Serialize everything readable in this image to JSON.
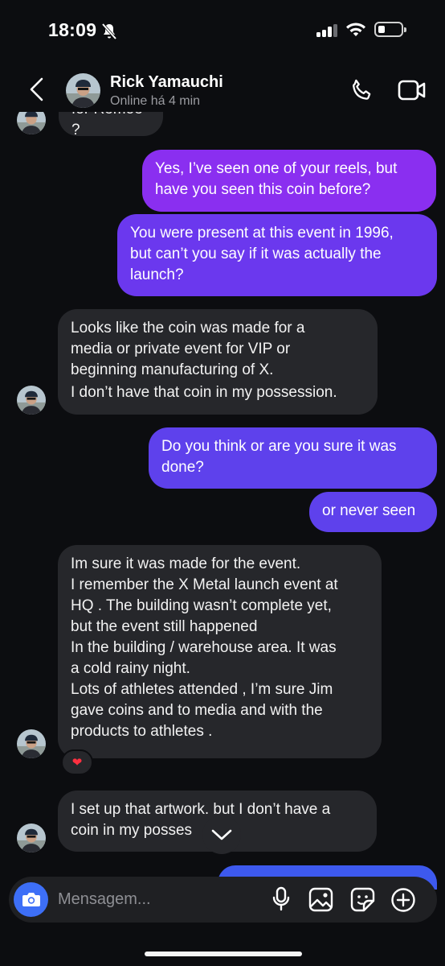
{
  "status_bar": {
    "time": "18:09"
  },
  "header": {
    "contact_name": "Rick Yamauchi",
    "contact_status": "Online há 4 min"
  },
  "messages": [
    {
      "from": "them",
      "lines": [
        "for Remoe ?"
      ],
      "cut_off": true
    },
    {
      "from": "me",
      "lines": [
        "Yes, I’ve seen one of your reels, but",
        "have you seen this coin before?"
      ]
    },
    {
      "from": "me",
      "lines": [
        "You were present at this event in 1996,",
        "but can’t you say if it was actually the",
        "launch?"
      ]
    },
    {
      "from": "them",
      "lines": [
        "Looks like the coin was made for a",
        "media or private event for VIP or",
        "beginning manufacturing of X.",
        "I don’t have that coin in my possession."
      ]
    },
    {
      "from": "me",
      "lines": [
        "Do you think or are you sure it was",
        "done?"
      ]
    },
    {
      "from": "me",
      "lines": [
        "or never seen"
      ]
    },
    {
      "from": "them",
      "lines": [
        "Im sure it was made for the event.",
        "I remember the X Metal launch event at",
        "HQ . The building wasn’t complete yet,",
        "but the event still happened",
        "In the building / warehouse area.  It was",
        "a cold rainy night.",
        "Lots of athletes attended , I’m sure Jim",
        "gave coins and to media and with the",
        "products to athletes ."
      ],
      "reaction": "❤"
    },
    {
      "from": "them",
      "lines": [
        "I set up that artwork. but I don’t have a",
        "coin in my posses"
      ]
    }
  ],
  "composer": {
    "placeholder": "Mensagem..."
  },
  "icons": {
    "back": "chevron-left-icon",
    "call": "phone-icon",
    "video": "video-camera-icon",
    "camera": "camera-icon",
    "mic": "microphone-icon",
    "gallery": "image-icon",
    "sticker": "sticker-icon",
    "add": "plus-circle-icon",
    "scroll": "chevron-down-icon"
  },
  "colors": {
    "background": "#0c0d10",
    "incoming_bubble": "#26272b",
    "outgoing_bubble_top": "#8a2ff0",
    "outgoing_bubble_bottom": "#5e41ec",
    "camera_button": "#3d6ff7"
  }
}
